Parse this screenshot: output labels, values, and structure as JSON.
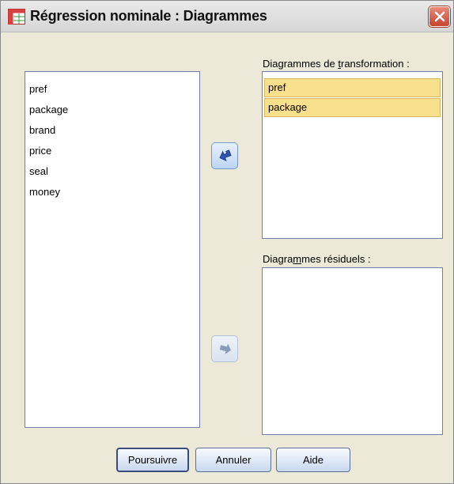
{
  "window": {
    "title": "Régression nominale : Diagrammes",
    "close_icon": "close-icon"
  },
  "source_list": {
    "items": [
      "pref",
      "package",
      "brand",
      "price",
      "seal",
      "money"
    ]
  },
  "transformation_plots": {
    "label_prefix": "Diagrammes de ",
    "label_hotkey": "t",
    "label_suffix": "ransformation :",
    "items": [
      "pref",
      "package"
    ],
    "selected": [
      "pref",
      "package"
    ],
    "move_button_icon": "arrow-left-icon"
  },
  "residual_plots": {
    "label_prefix": "Diagra",
    "label_hotkey": "m",
    "label_suffix": "mes résiduels :",
    "items": [],
    "move_button_icon": "arrow-right-icon"
  },
  "buttons": {
    "continue": "Poursuivre",
    "cancel": "Annuler",
    "help": "Aide"
  },
  "colors": {
    "selection": "#f8e08c",
    "dialog_bg": "#ece9d8",
    "close_button": "#c8432f"
  }
}
